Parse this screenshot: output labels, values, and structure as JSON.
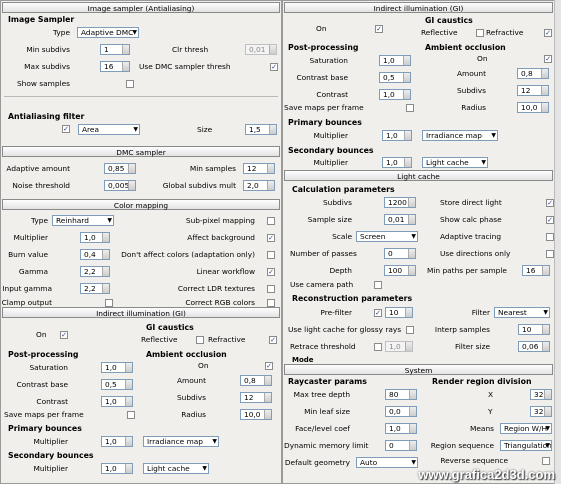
{
  "left": {
    "image_sampler": {
      "rollout": "Image sampler (Antialiasing)",
      "group_title": "Image Sampler",
      "type_label": "Type",
      "type_value": "Adaptive DMC",
      "min_subdivs_label": "Min subdivs",
      "min_subdivs_value": "1",
      "max_subdivs_label": "Max subdivs",
      "max_subdivs_value": "16",
      "clr_thresh_label": "Clr thresh",
      "clr_thresh_value": "0,01",
      "use_dmc_label": "Use DMC sampler thresh",
      "show_samples_label": "Show samples"
    },
    "aa_filter": {
      "group_title": "Antialiasing filter",
      "filter_value": "Area",
      "size_label": "Size",
      "size_value": "1,5"
    },
    "dmc": {
      "rollout": "DMC sampler",
      "adaptive_amount_label": "Adaptive amount",
      "adaptive_amount_value": "0,85",
      "min_samples_label": "Min samples",
      "min_samples_value": "12",
      "noise_threshold_label": "Noise threshold",
      "noise_threshold_value": "0,005",
      "global_subdivs_label": "Global subdivs mult",
      "global_subdivs_value": "2,0"
    },
    "color_mapping": {
      "rollout": "Color mapping",
      "type_label": "Type",
      "type_value": "Reinhard",
      "subpixel_label": "Sub-pixel mapping",
      "multiplier_label": "Multiplier",
      "multiplier_value": "1,0",
      "affect_bg_label": "Affect background",
      "burn_label": "Burn value",
      "burn_value": "0,4",
      "dont_affect_label": "Don't affect colors (adaptation only)",
      "gamma_label": "Gamma",
      "gamma_value": "2,2",
      "linear_label": "Linear workflow",
      "input_gamma_label": "Input gamma",
      "input_gamma_value": "2,2",
      "correct_ldr_label": "Correct LDR textures",
      "clamp_label": "Clamp output",
      "correct_rgb_label": "Correct RGB colors"
    },
    "gi": {
      "rollout": "Indirect illumination (GI)",
      "on_label": "On",
      "caustics_title": "GI caustics",
      "reflective_label": "Reflective",
      "refractive_label": "Refractive",
      "pp_title": "Post-processing",
      "saturation_label": "Saturation",
      "saturation_value": "1,0",
      "contrast_base_label": "Contrast base",
      "contrast_base_value": "0,5",
      "contrast_label": "Contrast",
      "contrast_value": "1,0",
      "save_maps_label": "Save maps per frame",
      "ao_title": "Ambient occlusion",
      "ao_on_label": "On",
      "amount_label": "Amount",
      "amount_value": "0,8",
      "subdivs_label": "Subdivs",
      "subdivs_value": "12",
      "radius_label": "Radius",
      "radius_value": "10,0",
      "primary_title": "Primary bounces",
      "primary_mult_label": "Multiplier",
      "primary_mult_value": "1,0",
      "primary_engine": "Irradiance map",
      "secondary_title": "Secondary bounces",
      "secondary_mult_label": "Multiplier",
      "secondary_mult_value": "1,0",
      "secondary_engine": "Light cache"
    }
  },
  "right": {
    "gi": {
      "rollout": "Indirect illumination (GI)",
      "on_label": "On",
      "caustics_title": "GI caustics",
      "reflective_label": "Reflective",
      "refractive_label": "Refractive",
      "pp_title": "Post-processing",
      "saturation_label": "Saturation",
      "saturation_value": "1,0",
      "contrast_base_label": "Contrast base",
      "contrast_base_value": "0,5",
      "contrast_label": "Contrast",
      "contrast_value": "1,0",
      "save_maps_label": "Save maps per frame",
      "ao_title": "Ambient occlusion",
      "ao_on_label": "On",
      "amount_label": "Amount",
      "amount_value": "0,8",
      "subdivs_label": "Subdivs",
      "subdivs_value": "12",
      "radius_label": "Radius",
      "radius_value": "10,0",
      "primary_title": "Primary bounces",
      "primary_mult_label": "Multiplier",
      "primary_mult_value": "1,0",
      "primary_engine": "Irradiance map",
      "secondary_title": "Secondary bounces",
      "secondary_mult_label": "Multiplier",
      "secondary_mult_value": "1,0",
      "secondary_engine": "Light cache"
    },
    "light_cache": {
      "rollout": "Light cache",
      "calc_title": "Calculation parameters",
      "subdivs_label": "Subdivs",
      "subdivs_value": "1200",
      "store_direct_label": "Store direct light",
      "sample_size_label": "Sample size",
      "sample_size_value": "0,01",
      "show_calc_label": "Show calc phase",
      "scale_label": "Scale",
      "scale_value": "Screen",
      "adaptive_tracing_label": "Adaptive tracing",
      "num_passes_label": "Number of passes",
      "num_passes_value": "0",
      "use_directions_label": "Use directions only",
      "depth_label": "Depth",
      "depth_value": "100",
      "min_paths_label": "Min paths per sample",
      "min_paths_value": "16",
      "use_camera_label": "Use camera path",
      "recon_title": "Reconstruction parameters",
      "prefilter_label": "Pre-filter",
      "prefilter_value": "10",
      "filter_label": "Filter",
      "filter_value": "Nearest",
      "glossy_label": "Use light cache for glossy rays",
      "interp_label": "Interp samples",
      "interp_value": "10",
      "retrace_label": "Retrace threshold",
      "retrace_value": "1,0",
      "filter_size_label": "Filter size",
      "filter_size_value": "0,06",
      "mode_label": "Mode"
    },
    "system": {
      "rollout": "System",
      "raycaster_title": "Raycaster params",
      "max_tree_label": "Max tree depth",
      "max_tree_value": "80",
      "min_leaf_label": "Min leaf size",
      "min_leaf_value": "0,0",
      "face_level_label": "Face/level coef",
      "face_level_value": "1,0",
      "dyn_mem_label": "Dynamic memory limit",
      "dyn_mem_value": "0",
      "default_geom_label": "Default geometry",
      "default_geom_value": "Auto",
      "region_title": "Render region division",
      "x_label": "X",
      "x_value": "32",
      "y_label": "Y",
      "y_value": "32",
      "means_label": "Means",
      "means_value": "Region W/H",
      "region_seq_label": "Region sequence",
      "region_seq_value": "Triangulation",
      "reverse_label": "Reverse sequence"
    }
  },
  "watermark": "www.grafica2d3d.com"
}
